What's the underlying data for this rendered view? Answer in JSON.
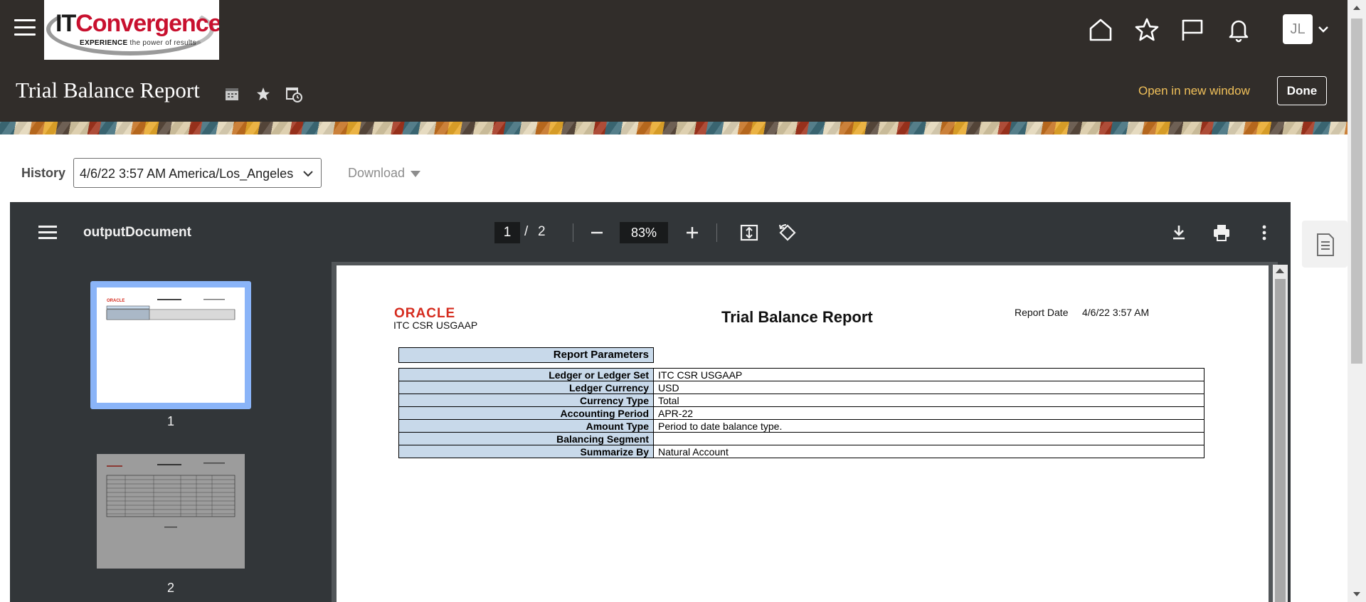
{
  "header": {
    "logo": {
      "brand_it": "IT",
      "brand_rest": "Convergence",
      "tagline_bold": "EXPERIENCE",
      "tagline_rest": " the power of results"
    },
    "icons": [
      "home-icon",
      "favorites-star-icon",
      "flag-icon",
      "notifications-bell-icon"
    ],
    "user_initials": "JL",
    "page_title": "Trial Balance Report",
    "open_new_window": "Open in new window",
    "done": "Done",
    "brand_color": "#312d2a",
    "link_color": "#f0c05a"
  },
  "history": {
    "label": "History",
    "selected": "4/6/22 3:57 AM America/Los_Angeles",
    "download": "Download"
  },
  "viewer": {
    "document_name": "outputDocument",
    "current_page": "1",
    "separator": "/",
    "total_pages": "2",
    "zoom": "83%",
    "thumbnails": [
      {
        "label": "1"
      },
      {
        "label": "2"
      }
    ]
  },
  "report": {
    "logo_text": "ORACLE",
    "org": "ITC CSR USGAAP",
    "title": "Trial Balance Report",
    "date_label": "Report Date",
    "date_value": "4/6/22 3:57 AM",
    "params_heading": "Report Parameters",
    "params": [
      {
        "key": "Ledger or Ledger Set",
        "value": "ITC CSR USGAAP"
      },
      {
        "key": "Ledger Currency",
        "value": "USD"
      },
      {
        "key": "Currency Type",
        "value": "Total"
      },
      {
        "key": "Accounting Period",
        "value": "APR-22"
      },
      {
        "key": "Amount Type",
        "value": "Period to date balance type."
      },
      {
        "key": "Balancing Segment",
        "value": ""
      },
      {
        "key": "Summarize By",
        "value": "Natural Account"
      }
    ]
  }
}
